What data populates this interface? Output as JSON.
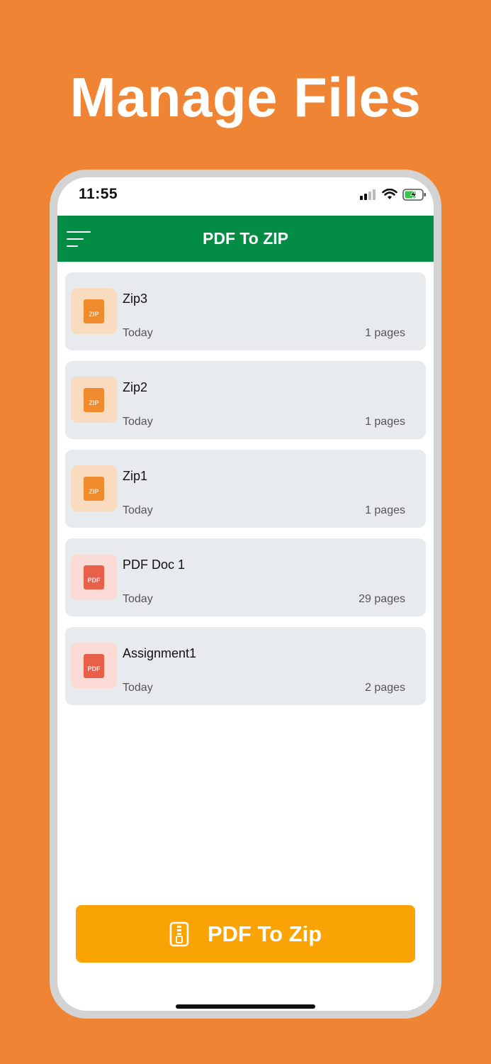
{
  "headline": "Manage Files",
  "status_bar": {
    "time": "11:55"
  },
  "app_bar": {
    "title": "PDF To ZIP"
  },
  "files": [
    {
      "name": "Zip3",
      "date": "Today",
      "pages": "1 pages",
      "type": "zip",
      "badge": "ZIP"
    },
    {
      "name": "Zip2",
      "date": "Today",
      "pages": "1 pages",
      "type": "zip",
      "badge": "ZIP"
    },
    {
      "name": "Zip1",
      "date": "Today",
      "pages": "1 pages",
      "type": "zip",
      "badge": "ZIP"
    },
    {
      "name": "PDF Doc 1",
      "date": "Today",
      "pages": "29 pages",
      "type": "pdf",
      "badge": "PDF"
    },
    {
      "name": "Assignment1",
      "date": "Today",
      "pages": "2 pages",
      "type": "pdf",
      "badge": "PDF"
    }
  ],
  "cta": {
    "label": "PDF To Zip",
    "icon": "zip-file-icon"
  },
  "colors": {
    "background": "#ee8434",
    "app_bar": "#028c44",
    "cta": "#faa305",
    "zip_icon": "#ef8a2d",
    "pdf_icon": "#e8604a"
  }
}
